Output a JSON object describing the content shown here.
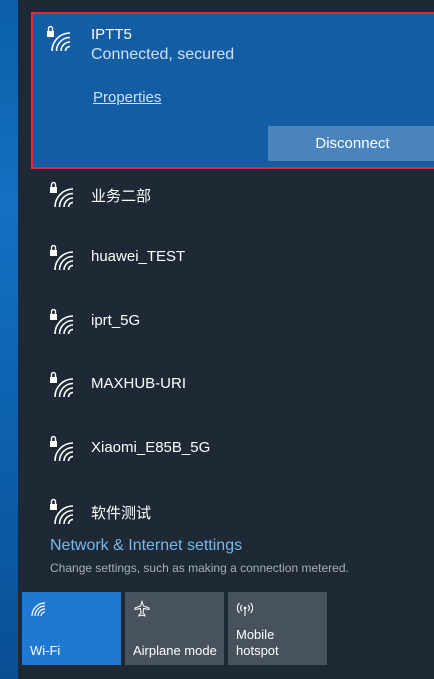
{
  "connected": {
    "name": "IPTT5",
    "status": "Connected, secured",
    "properties_label": "Properties",
    "disconnect_label": "Disconnect"
  },
  "networks": [
    {
      "name": "业务二部",
      "icon": "wifi-secured-icon"
    },
    {
      "name": "huawei_TEST",
      "icon": "wifi-secured-icon"
    },
    {
      "name": "iprt_5G",
      "icon": "wifi-secured-icon"
    },
    {
      "name": "MAXHUB-URI",
      "icon": "wifi-secured-icon"
    },
    {
      "name": "Xiaomi_E85B_5G",
      "icon": "wifi-secured-icon"
    },
    {
      "name": "软件测试",
      "icon": "wifi-secured-icon"
    }
  ],
  "settings": {
    "link": "Network & Internet settings",
    "description": "Change settings, such as making a connection metered."
  },
  "quick_actions": [
    {
      "label": "Wi-Fi",
      "icon": "wifi-icon",
      "active": true
    },
    {
      "label": "Airplane mode",
      "icon": "airplane-icon",
      "active": false
    },
    {
      "label": "Mobile hotspot",
      "icon": "hotspot-icon",
      "active": false
    }
  ],
  "colors": {
    "accent": "#1f78d1",
    "connected_bg": "#135da4",
    "highlight_border": "#e8283a",
    "link": "#76b9ed"
  }
}
